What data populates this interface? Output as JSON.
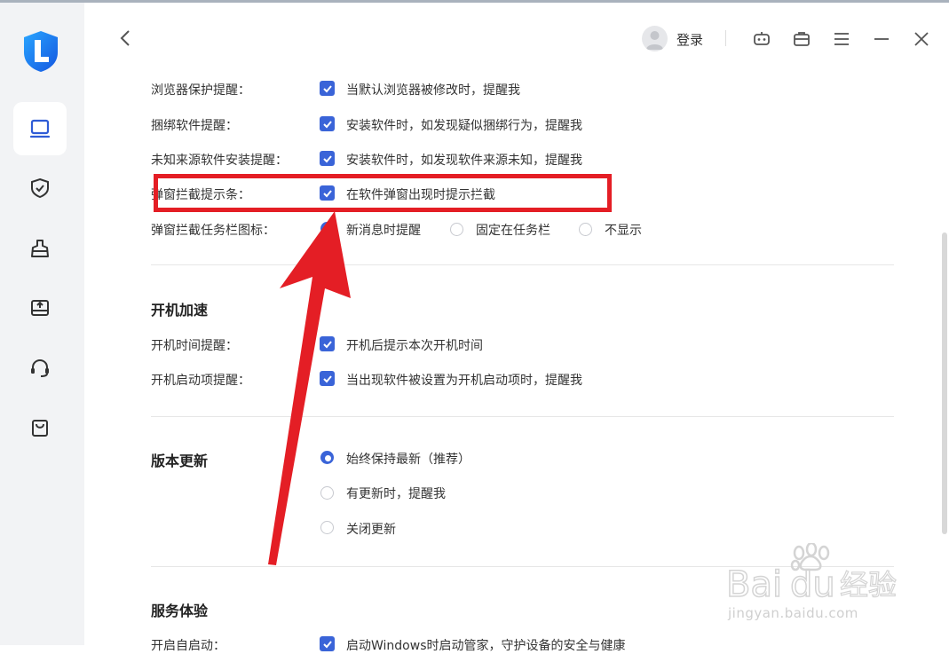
{
  "header": {
    "login_label": "登录"
  },
  "icons": {
    "back": "chevron-left-icon",
    "robot": "robot-icon",
    "toolbox": "toolbox-icon",
    "menu": "menu-icon",
    "minimize": "minimize-icon",
    "close": "close-icon"
  },
  "sidebar": {
    "items": [
      {
        "icon": "monitor-icon",
        "active": true
      },
      {
        "icon": "shield-check-icon",
        "active": false
      },
      {
        "icon": "broom-icon",
        "active": false
      },
      {
        "icon": "upload-drive-icon",
        "active": false
      },
      {
        "icon": "headset-icon",
        "active": false
      },
      {
        "icon": "shopping-bag-icon",
        "active": false
      }
    ]
  },
  "alerts": {
    "rows": [
      {
        "label": "浏览器保护提醒：",
        "text": "当默认浏览器被修改时，提醒我",
        "checked": true
      },
      {
        "label": "捆绑软件提醒：",
        "text": "安装软件时，如发现疑似捆绑行为，提醒我",
        "checked": true
      },
      {
        "label": "未知来源软件安装提醒：",
        "text": "安装软件时，如发现软件来源未知，提醒我",
        "checked": true
      },
      {
        "label": "弹窗拦截提示条：",
        "text": "在软件弹窗出现时提示拦截",
        "checked": true
      }
    ],
    "taskbar": {
      "label": "弹窗拦截任务栏图标：",
      "options": [
        "新消息时提醒",
        "固定在任务栏",
        "不显示"
      ],
      "selected": "新消息时提醒"
    }
  },
  "boot": {
    "title": "开机加速",
    "rows": [
      {
        "label": "开机时间提醒：",
        "text": "开机后提示本次开机时间",
        "checked": true
      },
      {
        "label": "开机启动项提醒：",
        "text": "当出现软件被设置为开机启动项时，提醒我",
        "checked": true
      }
    ]
  },
  "update": {
    "title": "版本更新",
    "options": [
      "始终保持最新（推荐）",
      "有更新时，提醒我",
      "关闭更新"
    ],
    "selected": "始终保持最新（推荐）"
  },
  "service": {
    "title": "服务体验",
    "row_label": "开启自启动：",
    "row_text": "启动Windows时启动管家，守护设备的安全与健康"
  },
  "watermark": {
    "brand": "Baidu经验",
    "url": "jingyan.baidu.com"
  },
  "colors": {
    "accent": "#3a64d8",
    "annotation_red": "#e41e25",
    "sidebar_bg": "#f2f3f5"
  }
}
